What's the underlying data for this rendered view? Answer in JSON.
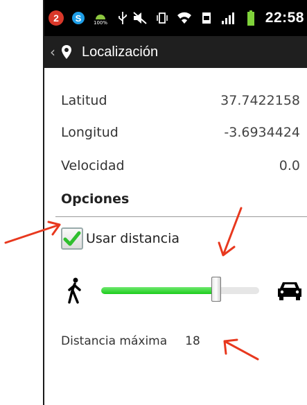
{
  "status_bar": {
    "notification_count": "2",
    "battery_small_label": "100%",
    "time": "22:58"
  },
  "action_bar": {
    "title": "Localización"
  },
  "info": {
    "rows": [
      {
        "label": "Latitud",
        "value": "37.7422158"
      },
      {
        "label": "Longitud",
        "value": "-3.6934424"
      },
      {
        "label": "Velocidad",
        "value": "0.0"
      }
    ]
  },
  "options": {
    "section_title": "Opciones",
    "use_distance_label": "Usar distancia",
    "use_distance_checked": true,
    "slider_value_fraction": 0.73,
    "max_distance_label": "Distancia máxima",
    "max_distance_value": "18"
  },
  "colors": {
    "accent_green": "#1ccc1c",
    "annotation_red": "#e8381e",
    "status_bar_bg": "#000000",
    "action_bar_bg": "#1f1f1f"
  },
  "icons": [
    "notification-badge-icon",
    "skype-icon",
    "android-battery-icon",
    "usb-icon",
    "mute-icon",
    "vibrate-icon",
    "wifi-icon",
    "sd-card-icon",
    "signal-icon",
    "battery-icon",
    "back-chevron-icon",
    "location-pin-icon",
    "walking-person-icon",
    "car-icon",
    "checkmark-icon"
  ]
}
